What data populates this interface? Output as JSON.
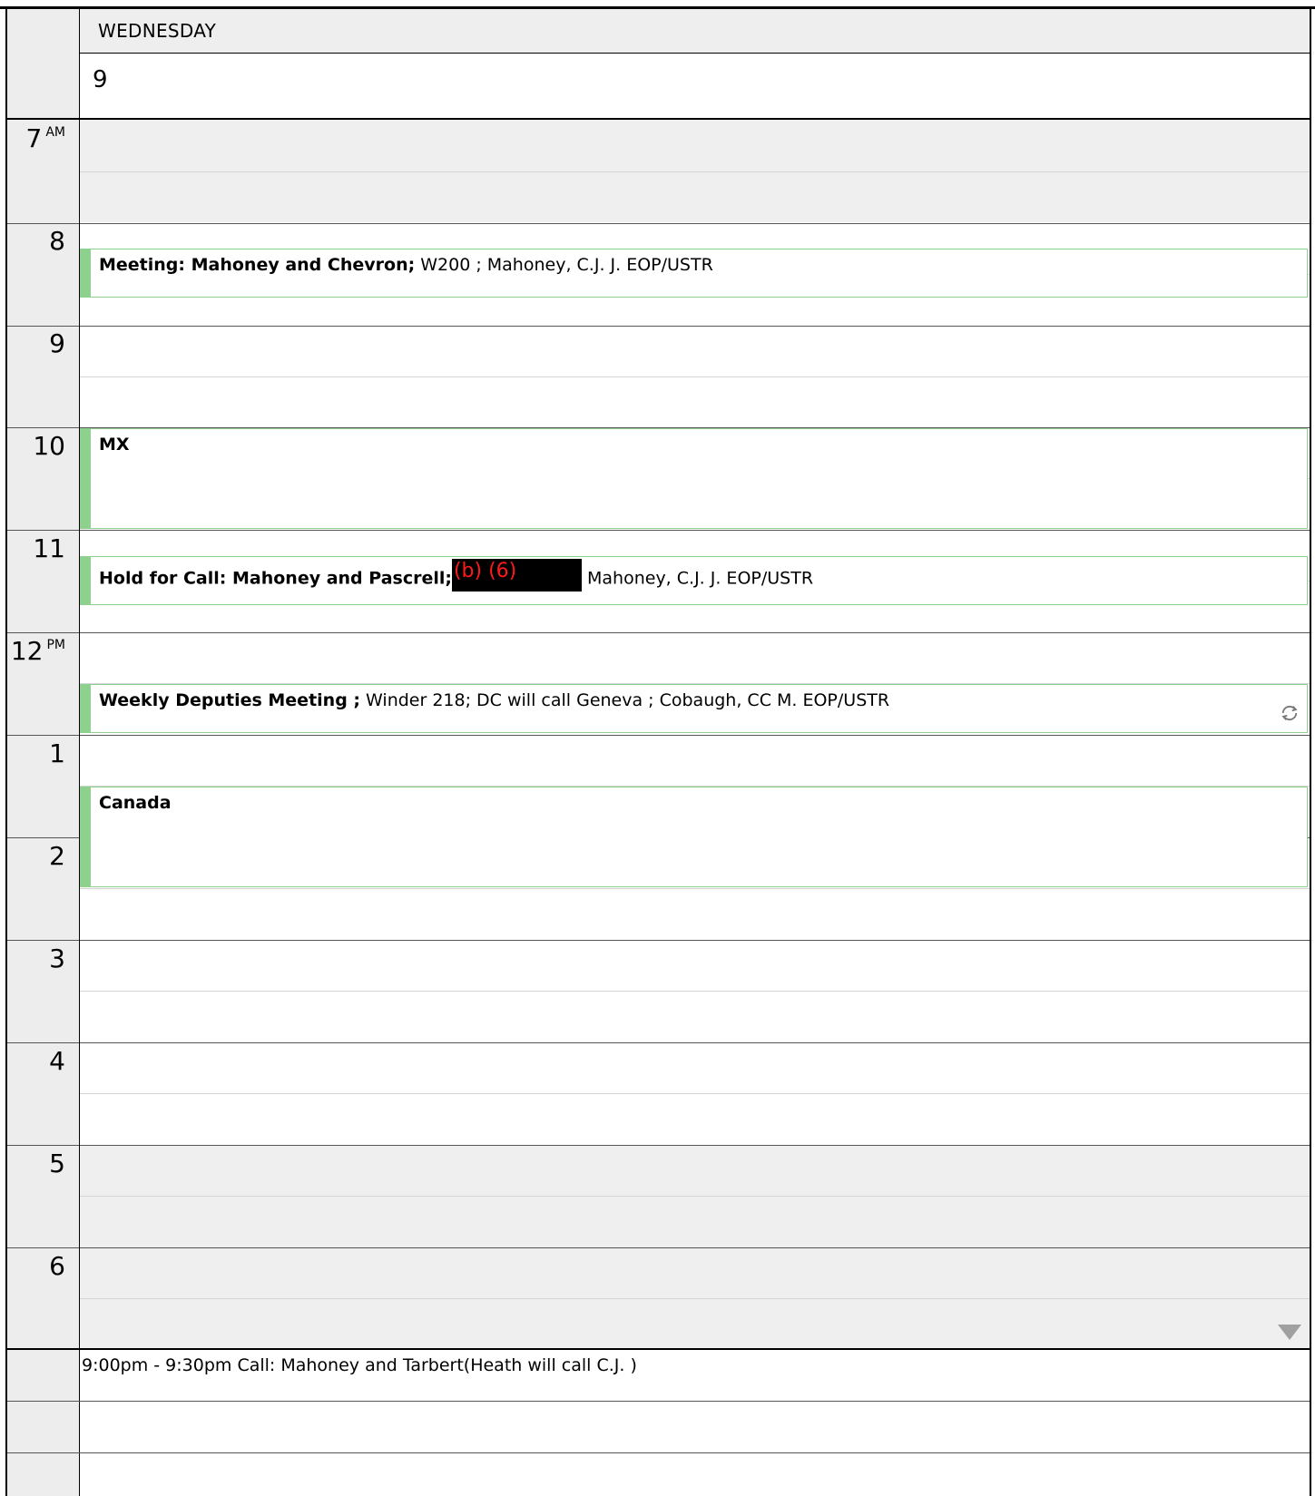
{
  "day": {
    "name": "WEDNESDAY",
    "number": "9"
  },
  "hours": [
    {
      "label": "7",
      "suffix": "AM"
    },
    {
      "label": "8",
      "suffix": ""
    },
    {
      "label": "9",
      "suffix": ""
    },
    {
      "label": "10",
      "suffix": ""
    },
    {
      "label": "11",
      "suffix": ""
    },
    {
      "label": "12",
      "suffix": "PM"
    },
    {
      "label": "1",
      "suffix": ""
    },
    {
      "label": "2",
      "suffix": ""
    },
    {
      "label": "3",
      "suffix": ""
    },
    {
      "label": "4",
      "suffix": ""
    },
    {
      "label": "5",
      "suffix": ""
    },
    {
      "label": "6",
      "suffix": ""
    }
  ],
  "events": [
    {
      "title": "Meeting: Mahoney and Chevron;",
      "details": " W200 ; Mahoney, C.J. J. EOP/USTR"
    },
    {
      "title": "MX",
      "details": ""
    },
    {
      "title": "Hold for Call: Mahoney and Pascrell;",
      "redaction": "(b) (6)",
      "details": " Mahoney, C.J. J. EOP/USTR"
    },
    {
      "title": "Weekly Deputies Meeting ;",
      "details": " Winder 218; DC will call Geneva ; Cobaugh, CC M. EOP/USTR"
    },
    {
      "title": "Canada",
      "details": ""
    }
  ],
  "tasks": [
    "9:00pm - 9:30pm Call: Mahoney and Tarbert(Heath will call C.J. )"
  ],
  "colors": {
    "event_accent": "#8ed08e",
    "redaction_text": "#ff1a1a",
    "off_hours": "#efefef"
  },
  "icons": {
    "recurrence": "recurrence-icon",
    "scroll": "scroll-down-icon"
  }
}
